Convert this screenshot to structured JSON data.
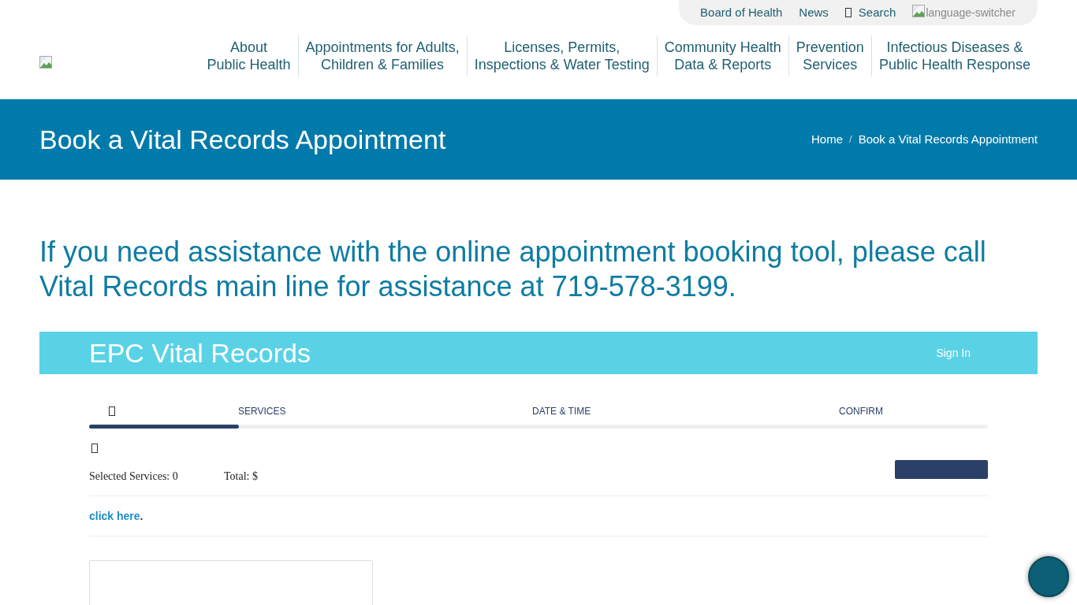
{
  "utility_nav": {
    "links": [
      "Board of Health",
      "News"
    ],
    "search": "Search",
    "language_switcher_alt": "language-switcher"
  },
  "main_nav": [
    {
      "lines": [
        "About",
        "Public Health"
      ]
    },
    {
      "lines": [
        "Appointments for Adults,",
        "Children & Families"
      ]
    },
    {
      "lines": [
        "Licenses, Permits,",
        "Inspections & Water Testing"
      ]
    },
    {
      "lines": [
        "Community Health",
        "Data & Reports"
      ]
    },
    {
      "lines": [
        "Prevention",
        "Services"
      ]
    },
    {
      "lines": [
        "Infectious Diseases &",
        "Public Health Response"
      ]
    }
  ],
  "banner": {
    "title": "Book a Vital Records Appointment",
    "breadcrumb": [
      "Home",
      "Book a Vital Records Appointment"
    ],
    "breadcrumb_separator": "/"
  },
  "notice": "If you need assistance with the online appointment booking tool, please call Vital Records main line for assistance at 719-578-3199.",
  "booking": {
    "title": "EPC Vital Records",
    "sign_in": "Sign In",
    "steps": [
      {
        "kind": "icon"
      },
      {
        "kind": "label",
        "label": "SERVICES"
      },
      {
        "kind": "label",
        "label": "DATE & TIME"
      },
      {
        "kind": "label",
        "label": "CONFIRM"
      }
    ],
    "progress": {
      "level": 0.167
    },
    "summary": {
      "selected_services": "Selected Services: 0",
      "total": "Total: $"
    },
    "help_link": "click here",
    "help_suffix": "."
  }
}
